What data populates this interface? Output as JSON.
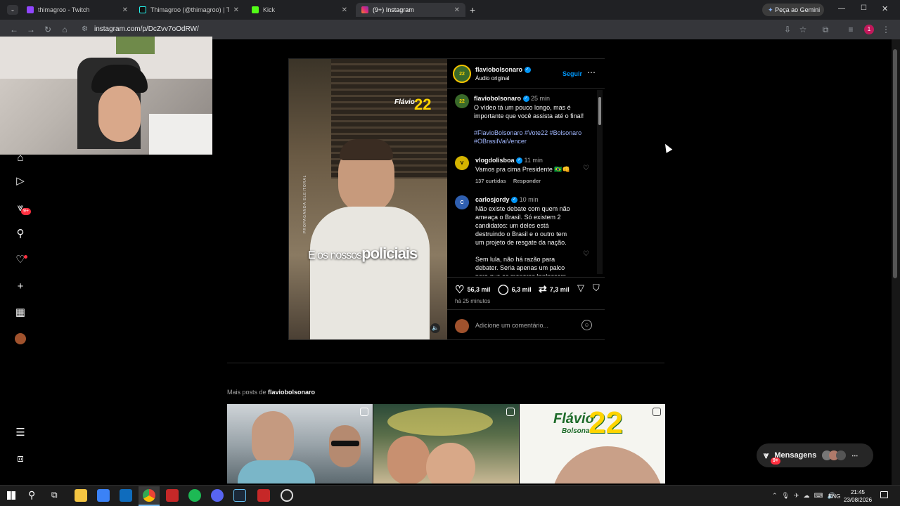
{
  "browser": {
    "tabs": [
      {
        "title": "thimagroo - Twitch",
        "color": "#9146ff"
      },
      {
        "title": "Thimagroo (@thimagroo) | Tik",
        "color": "#000000"
      },
      {
        "title": "Kick",
        "color": "#53fc18"
      },
      {
        "title": "(9+) Instagram",
        "color": "#e1306c"
      }
    ],
    "new_tab": "+",
    "gemini_button": "Peça ao Gemini",
    "url": "instagram.com/p/DcZvv7oOdRW/",
    "profile_initial": "1"
  },
  "sidebar": {
    "notifications_badge": "9+"
  },
  "post": {
    "video_caption_part1": "E os nossos",
    "video_caption_part2": "policiais",
    "video_logo_name": "Flávio",
    "video_logo_number": "22",
    "video_side_text": "PROPAGANDA ELEITORAL",
    "author": "flaviobolsonaro",
    "audio": "Áudio original",
    "follow": "Seguir",
    "caption_time": "25 min",
    "caption_text": "O vídeo tá um pouco longo, mas é importante que você assista até o final!",
    "caption_hashtags": "#FlavioBolsonaro #Vote22 #Bolsonaro #OBrasilVaiVencer",
    "comments": [
      {
        "user": "vlogdolisboa",
        "time": "11 min",
        "text": "Vamos pra cima Presidente 🇧🇷👊",
        "likes": "137 curtidas",
        "reply": "Responder"
      },
      {
        "user": "carlosjordy",
        "time": "10 min",
        "text": "Não existe debate com quem não ameaça o Brasil. Só existem 2 candidatos: um deles está destruindo o Brasil e o outro tem um projeto de resgate da nação.",
        "text2": "Sem lula, não há razão para debater. Seria apenas um palco para que os menores tentassem"
      }
    ],
    "likes": "56,3 mil",
    "comment_count": "6,3 mil",
    "reposts": "7,3 mil",
    "posted": "há 25 minutos",
    "add_comment_placeholder": "Adicione um comentário..."
  },
  "more_posts": {
    "label_prefix": "Mais posts de ",
    "label_user": "flaviobolsonaro",
    "thumb3_name": "Flávio",
    "thumb3_sub": "Bolsonaro",
    "thumb3_number": "22"
  },
  "messages": {
    "label": "Mensagens",
    "badge": "9+"
  },
  "taskbar": {
    "lang": "ENG",
    "time": "21:45",
    "date": "23/08/2026"
  }
}
